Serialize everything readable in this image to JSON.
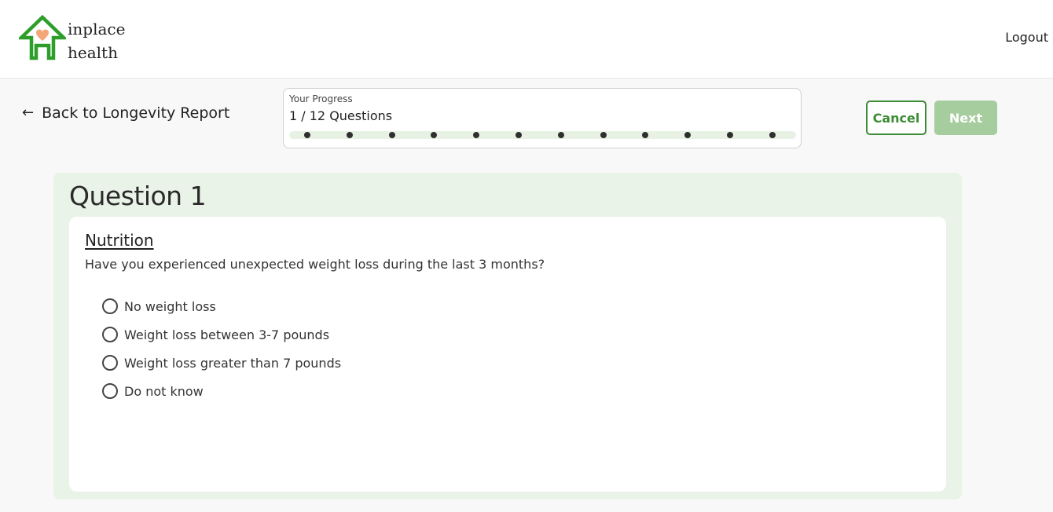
{
  "header": {
    "brand_line1": "inplace",
    "brand_line2": "health",
    "logout_label": "Logout"
  },
  "nav": {
    "back_label": "Back to Longevity Report"
  },
  "progress": {
    "title": "Your Progress",
    "count_text": "1 / 12 Questions",
    "current": 1,
    "total": 12
  },
  "actions": {
    "cancel_label": "Cancel",
    "next_label": "Next"
  },
  "question": {
    "heading": "Question 1",
    "section": "Nutrition",
    "text": "Have you experienced unexpected weight loss during the last 3 months?",
    "options": [
      "No weight loss",
      "Weight loss between 3-7 pounds",
      "Weight loss greater than 7 pounds",
      "Do not know"
    ]
  },
  "colors": {
    "brand_green": "#2e9e2a",
    "heart": "#f5a678",
    "accent_green": "#3d8c36",
    "next_disabled": "#a6cd9d",
    "panel_bg": "#eaf3e7"
  }
}
